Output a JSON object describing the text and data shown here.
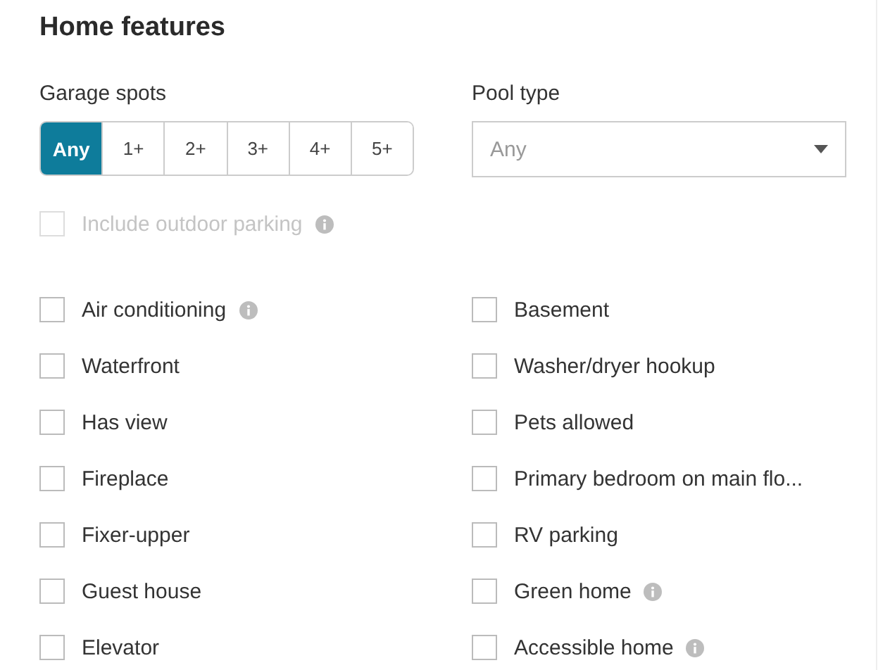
{
  "title": "Home features",
  "garage": {
    "label": "Garage spots",
    "options": [
      {
        "label": "Any",
        "selected": true
      },
      {
        "label": "1+",
        "selected": false
      },
      {
        "label": "2+",
        "selected": false
      },
      {
        "label": "3+",
        "selected": false
      },
      {
        "label": "4+",
        "selected": false
      },
      {
        "label": "5+",
        "selected": false
      }
    ]
  },
  "pool": {
    "label": "Pool type",
    "placeholder": "Any"
  },
  "outdoor_parking": {
    "label": "Include outdoor parking",
    "checked": false,
    "disabled": true,
    "info": true
  },
  "features": [
    {
      "label": "Air conditioning",
      "checked": false,
      "info": true
    },
    {
      "label": "Basement",
      "checked": false,
      "info": false
    },
    {
      "label": "Waterfront",
      "checked": false,
      "info": false
    },
    {
      "label": "Washer/dryer hookup",
      "checked": false,
      "info": false
    },
    {
      "label": "Has view",
      "checked": false,
      "info": false
    },
    {
      "label": "Pets allowed",
      "checked": false,
      "info": false
    },
    {
      "label": "Fireplace",
      "checked": false,
      "info": false
    },
    {
      "label": "Primary bedroom on main flo...",
      "checked": false,
      "info": false
    },
    {
      "label": "Fixer-upper",
      "checked": false,
      "info": false
    },
    {
      "label": "RV parking",
      "checked": false,
      "info": false
    },
    {
      "label": "Guest house",
      "checked": false,
      "info": false
    },
    {
      "label": "Green home",
      "checked": false,
      "info": true
    },
    {
      "label": "Elevator",
      "checked": false,
      "info": false
    },
    {
      "label": "Accessible home",
      "checked": false,
      "info": true
    }
  ]
}
